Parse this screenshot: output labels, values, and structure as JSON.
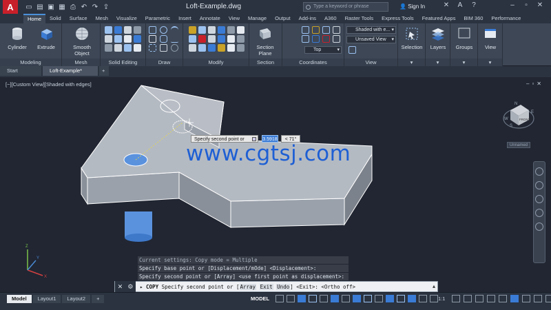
{
  "titlebar": {
    "title": "Loft-Example.dwg",
    "search_placeholder": "Type a keyword or phrase",
    "signin_label": "Sign In",
    "logo_letter": "A"
  },
  "ribbon_tabs": [
    "Home",
    "Solid",
    "Surface",
    "Mesh",
    "Visualize",
    "Parametric",
    "Insert",
    "Annotate",
    "View",
    "Manage",
    "Output",
    "Add-ins",
    "A360",
    "Raster Tools",
    "Express Tools",
    "Featured Apps",
    "BIM 360",
    "Performance"
  ],
  "ribbon": {
    "cylinder_label": "Cylinder",
    "extrude_label": "Extrude",
    "smooth_object_label": "Smooth Object",
    "section_plane_label": "Section Plane",
    "selection_label": "Selection",
    "layers_label": "Layers",
    "groups_label": "Groups",
    "view_label": "View",
    "visual_style": "Shaded with e...",
    "saved_view": "Unsaved View",
    "ucs_view": "Top",
    "panels": {
      "modeling": "Modeling",
      "mesh": "Mesh",
      "solid_editing": "Solid Editing",
      "draw": "Draw",
      "modify": "Modify",
      "section": "Section",
      "coordinates": "Coordinates",
      "view": "View"
    }
  },
  "file_tabs": {
    "start": "Start",
    "active": "Loft-Example*",
    "plus": "+"
  },
  "viewport": {
    "label": "[−][Custom View][Shaded with edges]",
    "viewcube_front": "FRONT",
    "viewcube_compass": [
      "N",
      "W",
      "E",
      "S"
    ],
    "named_view": "Unnamed",
    "tooltip_text": "Specify second point or",
    "dynamic_value": "3.5918",
    "angle_value": "< 71°",
    "watermark": "www.cgtsj.com"
  },
  "command_history": [
    "Current settings:  Copy mode = Multiple",
    "Specify base point or [Displacement/mOde] <Displacement>:",
    "Specify second point or [Array] <use first point as displacement>:"
  ],
  "command_line": {
    "cmd": "COPY",
    "prompt": "Specify second point or [",
    "opt_array": "Array",
    "opt_exit": "Exit",
    "opt_undo": "Undo",
    "tail": "] <Exit>:  <Ortho off>"
  },
  "status": {
    "layout_tabs": [
      "Model",
      "Layout1",
      "Layout2",
      "+"
    ],
    "model_label": "MODEL",
    "scale": "1:1"
  },
  "colors": {
    "accent": "#3a7bd5",
    "logo": "#c8202a",
    "watermark": "#1e5fd4"
  }
}
